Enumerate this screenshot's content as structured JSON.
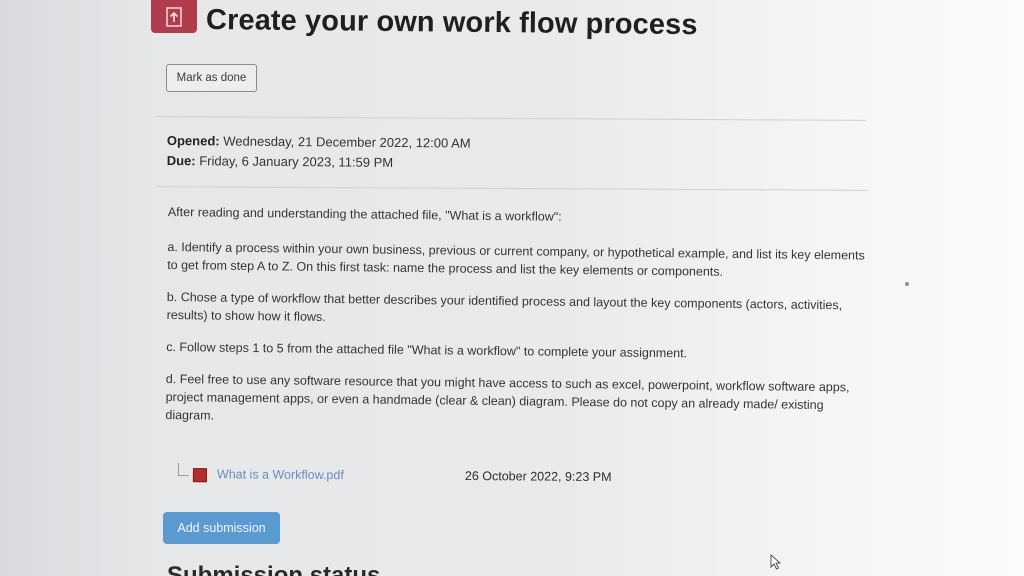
{
  "header": {
    "title": "Create your own work flow process",
    "icon": "assignment-upload-icon",
    "icon_color": "#b03c4e"
  },
  "completion": {
    "mark_done_label": "Mark as done"
  },
  "dates": {
    "opened_label": "Opened:",
    "opened_value": "Wednesday, 21 December 2022, 12:00 AM",
    "due_label": "Due:",
    "due_value": "Friday, 6 January 2023, 11:59 PM"
  },
  "description": {
    "intro": "After reading and understanding the attached file, \"What is a workflow\":",
    "items": [
      "a. Identify a process within your own business, previous or current company, or hypothetical example, and list its key elements to get from step A to Z. On this first task: name the process and list the key elements or components.",
      "b. Chose a type of workflow that better describes your identified process and layout the key components (actors, activities, results) to show how it flows.",
      "c. Follow steps 1 to 5 from the attached file \"What is a workflow\" to complete your assignment.",
      "d. Feel free to use any software resource that you might have access to such as excel, powerpoint, workflow software apps, project management apps, or even a handmade (clear & clean) diagram. Please do not copy an already made/ existing diagram."
    ]
  },
  "attachment": {
    "icon": "pdf-file-icon",
    "file_name": "What is a Workflow.pdf",
    "date": "26 October 2022, 9:23 PM"
  },
  "actions": {
    "add_submission_label": "Add submission",
    "button_color": "#5a9ad1"
  },
  "submission": {
    "heading": "Submission status"
  }
}
